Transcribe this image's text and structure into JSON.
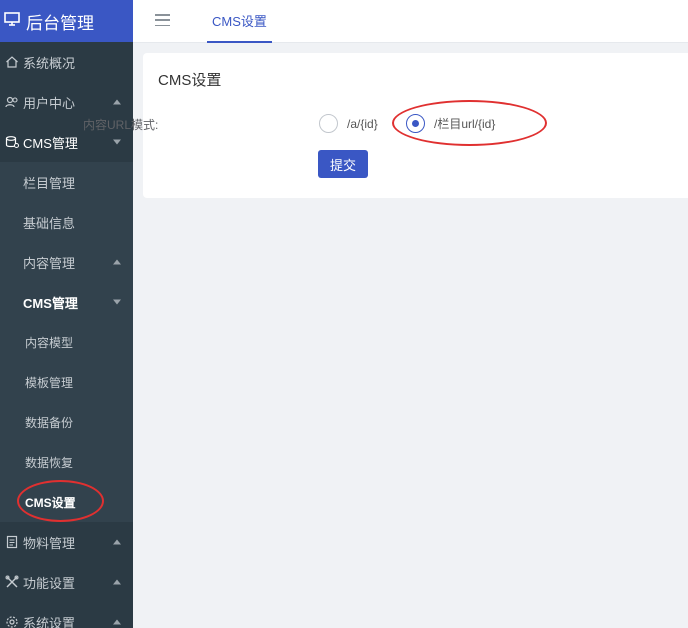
{
  "brand": {
    "title": "后台管理",
    "icon": "monitor-icon"
  },
  "sidebar": {
    "items": [
      {
        "label": "系统概况",
        "icon": "home-icon"
      },
      {
        "label": "用户中心",
        "icon": "users-icon"
      },
      {
        "label": "CMS管理",
        "icon": "cms-icon"
      },
      {
        "label": "栏目管理"
      },
      {
        "label": "基础信息"
      },
      {
        "label": "内容管理"
      },
      {
        "label": "CMS管理"
      },
      {
        "label": "内容模型"
      },
      {
        "label": "模板管理"
      },
      {
        "label": "数据备份"
      },
      {
        "label": "数据恢复"
      },
      {
        "label": "CMS设置"
      },
      {
        "label": "物料管理",
        "icon": "document-icon"
      },
      {
        "label": "功能设置",
        "icon": "tools-icon"
      },
      {
        "label": "系统设置",
        "icon": "gear-icon"
      }
    ]
  },
  "topbar": {
    "tab_label": "CMS设置"
  },
  "card": {
    "title": "CMS设置",
    "form_label": "内容URL模式:",
    "options": [
      "/a/{id}",
      "/栏目url/{id}"
    ],
    "selected": "/栏目url/{id}",
    "submit_label": "提交"
  },
  "colors": {
    "accent": "#3a57c4",
    "sidebar_bg": "#2b3a44",
    "annotation": "#e03030"
  }
}
